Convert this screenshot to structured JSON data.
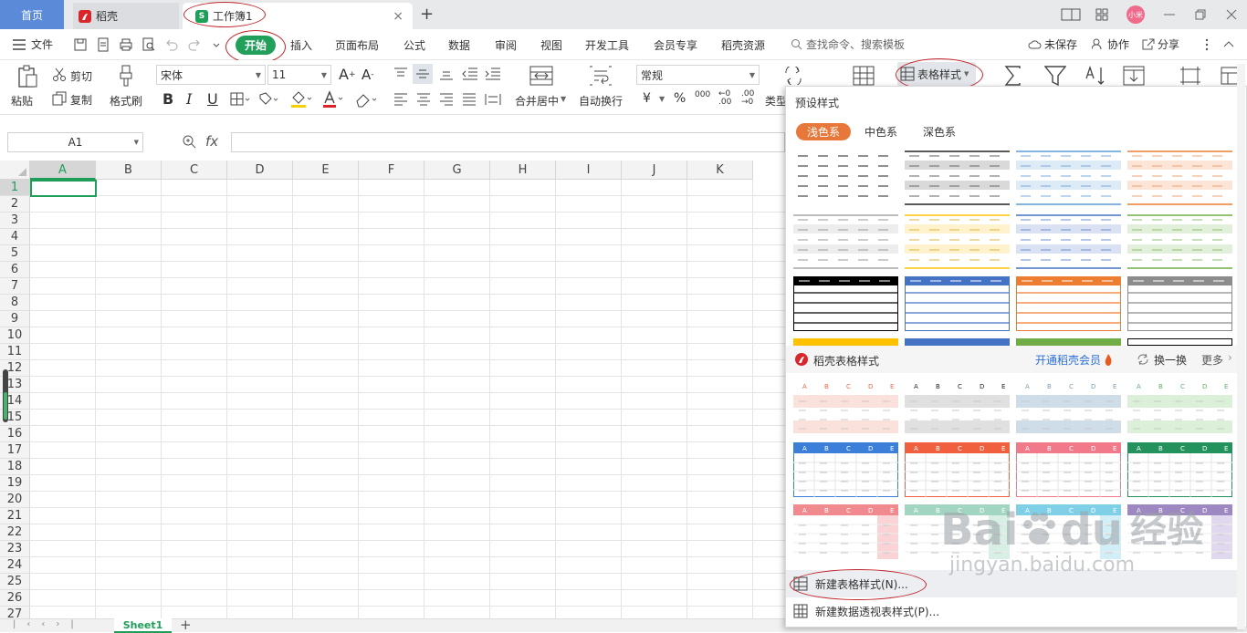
{
  "titlebar": {
    "home_tab": "首页",
    "tab_daoke": "稻壳",
    "tab_workbook": "工作簿1",
    "wps_icon_text": "S",
    "close_glyph": "×",
    "add_glyph": "+",
    "avatar_text": "小米"
  },
  "menubar": {
    "file": "文件",
    "start": "开始",
    "items": [
      "插入",
      "页面布局",
      "公式",
      "数据",
      "审阅",
      "视图",
      "开发工具",
      "会员专享",
      "稻壳资源"
    ],
    "search_placeholder": "查找命令、搜索模板",
    "unsaved": "未保存",
    "collab": "协作",
    "share": "分享"
  },
  "ribbon": {
    "paste": "粘贴",
    "cut": "剪切",
    "copy": "复制",
    "format_painter": "格式刷",
    "font_name": "宋体",
    "font_size": "11",
    "merge_center": "合并居中",
    "wrap_text": "自动换行",
    "number_format": "常规",
    "currency": "¥",
    "percent": "%",
    "thousands": "000",
    "type_convert": "类型",
    "table_style": "表格样式"
  },
  "formula_bar": {
    "name_box": "A1",
    "fx": "fx",
    "value": ""
  },
  "grid": {
    "columns": [
      "A",
      "B",
      "C",
      "D",
      "E",
      "F",
      "G",
      "H",
      "I",
      "J",
      "K"
    ],
    "rows": [
      "1",
      "2",
      "3",
      "4",
      "5",
      "6",
      "7",
      "8",
      "9",
      "10",
      "11",
      "12",
      "13",
      "14",
      "15",
      "16",
      "17",
      "18",
      "19",
      "20",
      "21",
      "22",
      "23",
      "24",
      "25",
      "26",
      "27"
    ],
    "selected_cell": "A1"
  },
  "statusbar": {
    "sheet_tab": "Sheet1",
    "add_sheet": "+"
  },
  "panel": {
    "title": "预设样式",
    "tabs": [
      "浅色系",
      "中色系",
      "深色系"
    ],
    "active_tab": "浅色系",
    "daoke_section": "稻壳表格样式",
    "open_member": "开通稻壳会员",
    "refresh": "换一换",
    "more": "更多",
    "new_table_style": "新建表格样式(N)...",
    "new_pivot_style": "新建数据透视表样式(P)...",
    "tile_header_letters": [
      "A",
      "B",
      "C",
      "D",
      "E"
    ]
  },
  "colors": {
    "accent_green": "#22a05b",
    "home_tab_blue": "#5b8bd8",
    "orange": "#e8773a",
    "highlight_red": "#c0262b"
  },
  "watermark": {
    "brand": "Bai",
    "brand2": "du",
    "cn": "经验",
    "url": "jingyan.baidu.com"
  }
}
